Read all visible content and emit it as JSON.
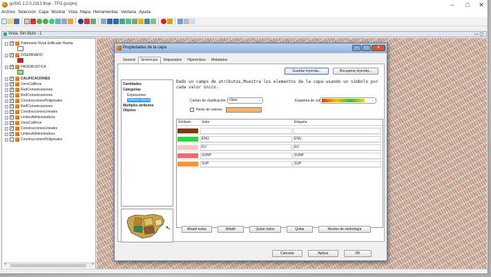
{
  "app": {
    "title": "gvSIG 2.2.0.2313 final - TFG.gvsproj",
    "window_controls": {
      "minimize": "–",
      "maximize": "□",
      "close": "✕"
    }
  },
  "menu": [
    "Archivo",
    "Selección",
    "Capa",
    "Mostrar",
    "Vista",
    "Mapa",
    "Herramientas",
    "Ventana",
    "Ayuda"
  ],
  "view": {
    "title": "Vista: Sin título - 1"
  },
  "toc": {
    "items": [
      {
        "label": "Patrimonio Rural Edificado Huerta",
        "expanded": true,
        "checked": true
      },
      {
        "label": "",
        "swatch": "#ffffff",
        "kind": "swatch"
      },
      {
        "label": "DISEMINADO",
        "expanded": true,
        "checked": true
      },
      {
        "label": "",
        "swatch": "#e0131a",
        "kind": "swatch"
      },
      {
        "label": "PAISDRUSTICA",
        "expanded": true,
        "checked": true
      },
      {
        "label": "",
        "swatch": "#8fe07a",
        "kind": "swatch"
      },
      {
        "label": "CALIFICACIONES",
        "expanded": false,
        "checked": true,
        "bold": true
      },
      {
        "label": "UsosCalificos",
        "expanded": false,
        "checked": true
      },
      {
        "label": "RedComunicaciones",
        "expanded": false,
        "checked": true
      },
      {
        "label": "RedComunicaciones",
        "expanded": false,
        "checked": true
      },
      {
        "label": "ConstruccionesPoligonales",
        "expanded": false,
        "checked": true
      },
      {
        "label": "RedComunicaciones",
        "expanded": false,
        "checked": true
      },
      {
        "label": "ConstruccionesLineales",
        "expanded": false,
        "checked": true
      },
      {
        "label": "LimitesAdministrativos",
        "expanded": false,
        "checked": true
      },
      {
        "label": "UsosCalificos",
        "expanded": false,
        "checked": true
      },
      {
        "label": "ConstruccionesLineales",
        "expanded": false,
        "checked": true
      },
      {
        "label": "LimitesAdministrativos",
        "expanded": false,
        "checked": true
      },
      {
        "label": "ConstruccionesPoligonales",
        "expanded": false,
        "checked": false
      }
    ],
    "scroll_left": "<",
    "scroll_right": ">"
  },
  "dialog": {
    "title": "Propiedades de la capa",
    "tabs": [
      "General",
      "Simbología",
      "Etiquetados",
      "Hiperenlace",
      "Metadatos"
    ],
    "active_tab": "Simbología",
    "save_legend": "Guardar leyenda...",
    "recover_legend": "Recuperar leyenda...",
    "tree": [
      {
        "label": "Cantidades",
        "level": 0,
        "bold": true
      },
      {
        "label": "Categorías",
        "level": 0,
        "bold": true
      },
      {
        "label": "Expresiones",
        "level": 1
      },
      {
        "label": "Valores únicos",
        "level": 1,
        "selected": true
      },
      {
        "label": "Múltiples atributos",
        "level": 0,
        "bold": true
      },
      {
        "label": "Objetos",
        "level": 0,
        "bold": true
      }
    ],
    "description": "Dado un campo de atributos,Muestra los elementos de la capa usando un símbolo por cada valor único.",
    "field_label": "Campo de clasificación:",
    "field_value": "clase",
    "color_scheme_label": "Esquema de color:",
    "rest_values_label": "Resto de valores:",
    "columns": {
      "symbol": "Símbolo",
      "value": "Valor",
      "label": "Etiqueta"
    },
    "rows": [
      {
        "color": "#7b3a10",
        "value": "",
        "label": ""
      },
      {
        "color": "#29d842",
        "value": "ENU",
        "label": "ENU"
      },
      {
        "color": "#f7c7c7",
        "value": "EU",
        "label": "EU"
      },
      {
        "color": "#f06b6b",
        "value": "SUNP",
        "label": "SUNP"
      },
      {
        "color": "#f7952b",
        "value": "SUP",
        "label": "SUP"
      }
    ],
    "add_all": "Añadir todos",
    "add": "Añadir",
    "remove_all": "Quitar todos",
    "remove": "Quitar",
    "symbol_levels": "Niveles de simbología",
    "cancel": "Cancelar",
    "apply": "Aplicar",
    "ok": "OK"
  }
}
